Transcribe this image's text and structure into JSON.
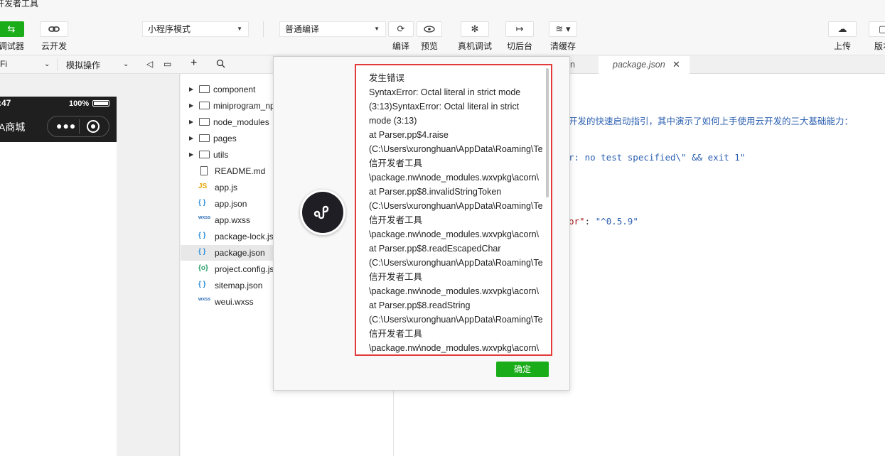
{
  "window": {
    "title": "开发者工具"
  },
  "toolbar": {
    "debugger_label": "调试器",
    "cloud_label": "云开发",
    "mode_select": "小程序模式",
    "compile_select": "普通编译",
    "compile_label": "编译",
    "preview_label": "预览",
    "device_debug_label": "真机调试",
    "background_label": "切后台",
    "clear_cache_label": "清缓存",
    "upload_label": "上传",
    "version_label": "版本"
  },
  "bar2": {
    "wifi": "Fi",
    "sim_op": "模拟操作"
  },
  "phone": {
    "time": ":47",
    "battery": "100%",
    "title": "A商城"
  },
  "tree": {
    "items": [
      {
        "name": "component",
        "type": "folder"
      },
      {
        "name": "miniprogram_np",
        "type": "folder"
      },
      {
        "name": "node_modules",
        "type": "folder"
      },
      {
        "name": "pages",
        "type": "folder"
      },
      {
        "name": "utils",
        "type": "folder"
      },
      {
        "name": "README.md",
        "type": "md"
      },
      {
        "name": "app.js",
        "type": "js"
      },
      {
        "name": "app.json",
        "type": "json"
      },
      {
        "name": "app.wxss",
        "type": "wxss"
      },
      {
        "name": "package-lock.js",
        "type": "json"
      },
      {
        "name": "package.json",
        "type": "json"
      },
      {
        "name": "project.config.js",
        "type": "config"
      },
      {
        "name": "sitemap.json",
        "type": "json"
      },
      {
        "name": "weui.wxss",
        "type": "wxss"
      }
    ]
  },
  "editor": {
    "tab_partial": "n",
    "active_tab": "package.json",
    "line_desc": "开发的快速启动指引，其中演示了如何上手使用云开发的三大基础能力：",
    "line_test": "r: no test specified\\\" && exit 1\"",
    "line_dep_key": "or\"",
    "line_dep_sep": ": ",
    "line_dep_val": "\"^0.5.9\""
  },
  "dialog": {
    "lines": [
      "发生错误",
      "SyntaxError: Octal literal in strict mode",
      "(3:13)SyntaxError: Octal literal in strict",
      "mode (3:13)",
      "at Parser.pp$4.raise",
      "(C:\\Users\\xuronghuan\\AppData\\Roaming\\Te",
      "信开发者工具",
      "\\package.nw\\node_modules.wxvpkg\\acorn\\",
      "at Parser.pp$8.invalidStringToken",
      "(C:\\Users\\xuronghuan\\AppData\\Roaming\\Te",
      "信开发者工具",
      "\\package.nw\\node_modules.wxvpkg\\acorn\\",
      "at Parser.pp$8.readEscapedChar",
      "(C:\\Users\\xuronghuan\\AppData\\Roaming\\Te",
      "信开发者工具",
      "\\package.nw\\node_modules.wxvpkg\\acorn\\",
      "at Parser.pp$8.readString",
      "(C:\\Users\\xuronghuan\\AppData\\Roaming\\Te",
      "信开发者工具",
      "\\package.nw\\node_modules.wxvpkg\\acorn\\"
    ],
    "ok_label": "确定"
  }
}
